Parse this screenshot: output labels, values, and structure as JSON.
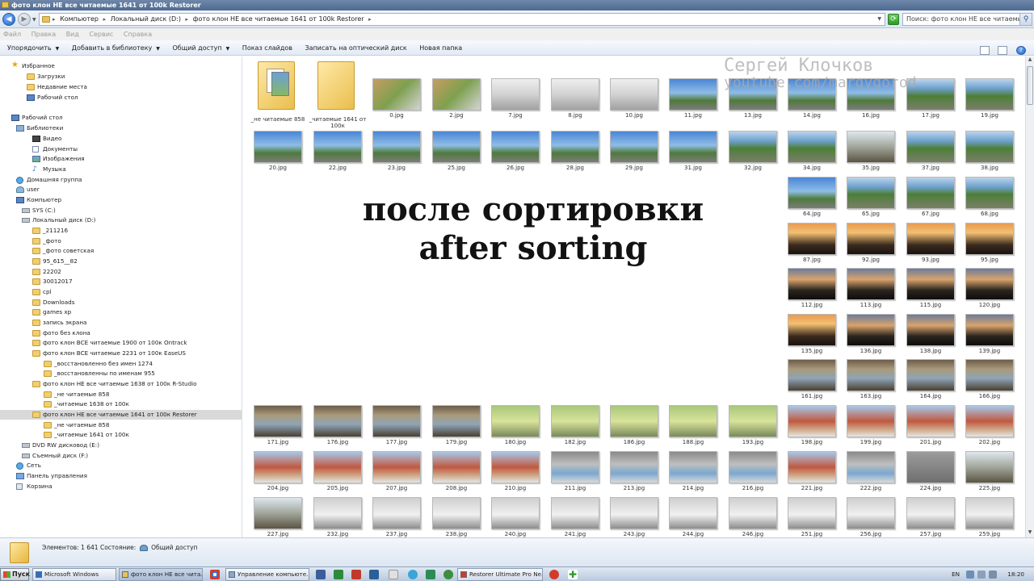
{
  "window": {
    "title": "фото клон НЕ все читаемые 1641 от 100k Restorer"
  },
  "address": {
    "crumbs": [
      "Компьютер",
      "Локальный диск (D:)",
      "фото клон НЕ все читаемые 1641 от 100k Restorer"
    ],
    "search_placeholder": "Поиск: фото клон НЕ все читаемые ..."
  },
  "menu": {
    "items": [
      "Файл",
      "Правка",
      "Вид",
      "Сервис",
      "Справка"
    ]
  },
  "toolbar": {
    "organize": "Упорядочить",
    "add_to_library": "Добавить в библиотеку",
    "share": "Общий доступ",
    "slideshow": "Показ слайдов",
    "burn": "Записать на оптический диск",
    "new_folder": "Новая папка"
  },
  "tree": {
    "items": [
      {
        "label": "Избранное",
        "icon": "star"
      },
      {
        "label": "Загрузки",
        "icon": "folder"
      },
      {
        "label": "Недавние места",
        "icon": "folder"
      },
      {
        "label": "Рабочий стол",
        "icon": "monitor"
      },
      {
        "label": "Рабочий стол",
        "icon": "monitor"
      },
      {
        "label": "Библиотеки",
        "icon": "lib"
      },
      {
        "label": "Видео",
        "icon": "video"
      },
      {
        "label": "Документы",
        "icon": "doc"
      },
      {
        "label": "Изображения",
        "icon": "img"
      },
      {
        "label": "Музыка",
        "icon": "music"
      },
      {
        "label": "Домашняя группа",
        "icon": "net"
      },
      {
        "label": "user",
        "icon": "user"
      },
      {
        "label": "Компьютер",
        "icon": "monitor"
      },
      {
        "label": "SYS (C:)",
        "icon": "drive"
      },
      {
        "label": "Локальный диск (D:)",
        "icon": "drive"
      },
      {
        "label": "_211216",
        "icon": "folder"
      },
      {
        "label": "_фото",
        "icon": "folder"
      },
      {
        "label": "_фото советская",
        "icon": "folder"
      },
      {
        "label": "95_615__82",
        "icon": "folder"
      },
      {
        "label": "22202",
        "icon": "folder"
      },
      {
        "label": "30012017",
        "icon": "folder"
      },
      {
        "label": "cpl",
        "icon": "folder"
      },
      {
        "label": "Downloads",
        "icon": "folder"
      },
      {
        "label": "games xp",
        "icon": "folder"
      },
      {
        "label": "запись экрана",
        "icon": "folder"
      },
      {
        "label": "фото без клона",
        "icon": "folder"
      },
      {
        "label": "фото клон ВСЕ читаемые 1900 от 100к Ontrack",
        "icon": "folder"
      },
      {
        "label": "фото клон ВСЕ читаемые 2231 от 100к EaseUS",
        "icon": "folder"
      },
      {
        "label": "_восстановленно без имен 1274",
        "icon": "folder"
      },
      {
        "label": "_восстановленны по именам 955",
        "icon": "folder"
      },
      {
        "label": "фото клон НЕ все читаемые 1638 от 100к R-Studio",
        "icon": "folder"
      },
      {
        "label": "_не читаемые 858",
        "icon": "folder"
      },
      {
        "label": "_читаемые 1638 от 100к",
        "icon": "folder"
      },
      {
        "label": "фото клон НЕ все читаемые 1641 от 100к Restorer",
        "icon": "folder"
      },
      {
        "label": "_не читаемые 858",
        "icon": "folder"
      },
      {
        "label": "_читаемые 1641 от 100к",
        "icon": "folder"
      },
      {
        "label": "DVD RW дисковод (E:)",
        "icon": "drive"
      },
      {
        "label": "Съемный диск (F:)",
        "icon": "drive"
      },
      {
        "label": "Сеть",
        "icon": "net"
      },
      {
        "label": "Панель управления",
        "icon": "panel"
      },
      {
        "label": "Корзина",
        "icon": "bin"
      }
    ]
  },
  "folders": [
    {
      "label": "_не читаемые 858"
    },
    {
      "label": "_читаемые 1641 от 100к"
    }
  ],
  "files": {
    "row1": [
      {
        "label": "0.jpg",
        "kind": "photo0"
      },
      {
        "label": "2.jpg",
        "kind": "photo0"
      },
      {
        "label": "7.jpg",
        "kind": "doc"
      },
      {
        "label": "8.jpg",
        "kind": "doc"
      },
      {
        "label": "10.jpg",
        "kind": "doc"
      },
      {
        "label": "11.jpg",
        "kind": "sky"
      },
      {
        "label": "13.jpg",
        "kind": "sky"
      },
      {
        "label": "14.jpg",
        "kind": "sky"
      },
      {
        "label": "16.jpg",
        "kind": "sky"
      },
      {
        "label": "17.jpg",
        "kind": "tree"
      },
      {
        "label": "19.jpg",
        "kind": "tree"
      }
    ],
    "row2": [
      {
        "label": "20.jpg",
        "kind": "sky"
      },
      {
        "label": "22.jpg",
        "kind": "sky"
      },
      {
        "label": "23.jpg",
        "kind": "sky"
      },
      {
        "label": "25.jpg",
        "kind": "sky"
      },
      {
        "label": "26.jpg",
        "kind": "sky"
      },
      {
        "label": "28.jpg",
        "kind": "sky"
      },
      {
        "label": "29.jpg",
        "kind": "sky"
      },
      {
        "label": "31.jpg",
        "kind": "sky"
      },
      {
        "label": "32.jpg",
        "kind": "tree"
      },
      {
        "label": "34.jpg",
        "kind": "tree"
      },
      {
        "label": "35.jpg",
        "kind": "street"
      },
      {
        "label": "37.jpg",
        "kind": "tree"
      },
      {
        "label": "38.jpg",
        "kind": "tree"
      }
    ],
    "right_rows": [
      [
        {
          "label": "64.jpg",
          "kind": "sky"
        },
        {
          "label": "65.jpg",
          "kind": "tree"
        },
        {
          "label": "67.jpg",
          "kind": "tree"
        },
        {
          "label": "68.jpg",
          "kind": "tree"
        }
      ],
      [
        {
          "label": "87.jpg",
          "kind": "sunset"
        },
        {
          "label": "92.jpg",
          "kind": "sunset"
        },
        {
          "label": "93.jpg",
          "kind": "sunset"
        },
        {
          "label": "95.jpg",
          "kind": "sunset"
        }
      ],
      [
        {
          "label": "112.jpg",
          "kind": "dusk"
        },
        {
          "label": "113.jpg",
          "kind": "dusk"
        },
        {
          "label": "115.jpg",
          "kind": "dusk"
        },
        {
          "label": "120.jpg",
          "kind": "dusk"
        }
      ],
      [
        {
          "label": "135.jpg",
          "kind": "sunset"
        },
        {
          "label": "136.jpg",
          "kind": "dusk"
        },
        {
          "label": "138.jpg",
          "kind": "dusk"
        },
        {
          "label": "139.jpg",
          "kind": "dusk"
        }
      ],
      [
        {
          "label": "161.jpg",
          "kind": "paint"
        },
        {
          "label": "163.jpg",
          "kind": "paint"
        },
        {
          "label": "164.jpg",
          "kind": "paint"
        },
        {
          "label": "166.jpg",
          "kind": "paint"
        }
      ]
    ],
    "row_a": [
      {
        "label": "171.jpg",
        "kind": "paint"
      },
      {
        "label": "176.jpg",
        "kind": "paint"
      },
      {
        "label": "177.jpg",
        "kind": "paint"
      },
      {
        "label": "179.jpg",
        "kind": "paint"
      },
      {
        "label": "180.jpg",
        "kind": "green"
      },
      {
        "label": "182.jpg",
        "kind": "green"
      },
      {
        "label": "186.jpg",
        "kind": "green"
      },
      {
        "label": "188.jpg",
        "kind": "green"
      },
      {
        "label": "193.jpg",
        "kind": "green"
      },
      {
        "label": "198.jpg",
        "kind": "church"
      },
      {
        "label": "199.jpg",
        "kind": "church"
      },
      {
        "label": "201.jpg",
        "kind": "church"
      },
      {
        "label": "202.jpg",
        "kind": "church"
      }
    ],
    "row_b": [
      {
        "label": "204.jpg",
        "kind": "church"
      },
      {
        "label": "205.jpg",
        "kind": "church"
      },
      {
        "label": "207.jpg",
        "kind": "church"
      },
      {
        "label": "208.jpg",
        "kind": "church"
      },
      {
        "label": "210.jpg",
        "kind": "church"
      },
      {
        "label": "211.jpg",
        "kind": "canvas"
      },
      {
        "label": "213.jpg",
        "kind": "canvas"
      },
      {
        "label": "214.jpg",
        "kind": "canvas"
      },
      {
        "label": "216.jpg",
        "kind": "canvas"
      },
      {
        "label": "221.jpg",
        "kind": "church"
      },
      {
        "label": "222.jpg",
        "kind": "canvas"
      },
      {
        "label": "224.jpg",
        "kind": "gray"
      },
      {
        "label": "225.jpg",
        "kind": "street"
      }
    ],
    "row_c": [
      {
        "label": "227.jpg",
        "kind": "street"
      },
      {
        "label": "232.jpg",
        "kind": "wall"
      },
      {
        "label": "237.jpg",
        "kind": "wall"
      },
      {
        "label": "238.jpg",
        "kind": "wall"
      },
      {
        "label": "240.jpg",
        "kind": "wall"
      },
      {
        "label": "241.jpg",
        "kind": "wall"
      },
      {
        "label": "243.jpg",
        "kind": "wall"
      },
      {
        "label": "244.jpg",
        "kind": "wall"
      },
      {
        "label": "246.jpg",
        "kind": "wall"
      },
      {
        "label": "251.jpg",
        "kind": "wall"
      },
      {
        "label": "256.jpg",
        "kind": "wall"
      },
      {
        "label": "257.jpg",
        "kind": "wall"
      },
      {
        "label": "259.jpg",
        "kind": "wall"
      }
    ]
  },
  "overlay": {
    "line1": "после сортировки",
    "line2": "after sorting"
  },
  "watermark": {
    "line1": "Сергей Клочков",
    "line2": "youtube.com/margygorod"
  },
  "details": {
    "count": "Элементов: 1 641",
    "state_label": "Состояние:",
    "state_value": "Общий доступ"
  },
  "taskbar": {
    "start": "Пуск",
    "tasks": [
      {
        "label": "Microsoft Windows"
      },
      {
        "label": "фото клон НЕ все чита..."
      },
      {
        "label": "Управление компьюте..."
      },
      {
        "label": "Restorer Ultimate Pro Ne..."
      }
    ],
    "lang": "EN",
    "clock": "18:20"
  },
  "colors": {
    "accent": "#1f5fc0",
    "selection": "#d9d9d9",
    "title": "#4d6a92"
  }
}
